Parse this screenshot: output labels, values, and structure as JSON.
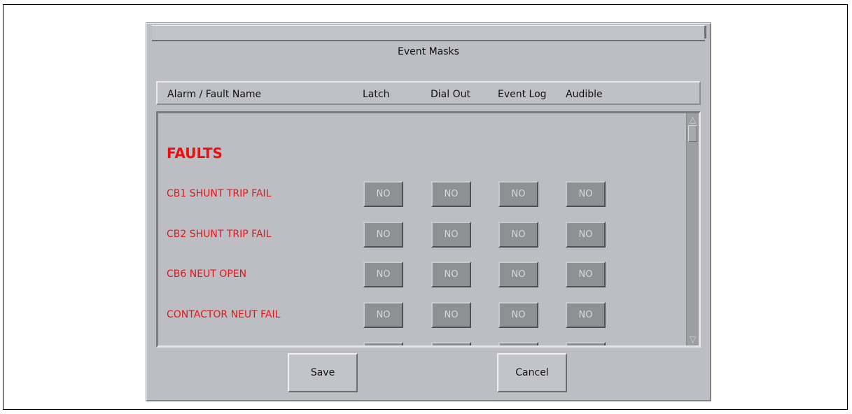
{
  "dialog": {
    "title": "Event Masks",
    "columns": {
      "name": "Alarm / Fault Name",
      "latch": "Latch",
      "dial_out": "Dial Out",
      "event_log": "Event Log",
      "audible": "Audible"
    },
    "section_heading": "FAULTS",
    "rows": [
      {
        "label": "CB1 SHUNT TRIP FAIL",
        "latch": "NO",
        "dial_out": "NO",
        "event_log": "NO",
        "audible": "NO"
      },
      {
        "label": "CB2 SHUNT TRIP FAIL",
        "latch": "NO",
        "dial_out": "NO",
        "event_log": "NO",
        "audible": "NO"
      },
      {
        "label": "CB6 NEUT OPEN",
        "latch": "NO",
        "dial_out": "NO",
        "event_log": "NO",
        "audible": "NO"
      },
      {
        "label": "CONTACTOR NEUT FAIL",
        "latch": "NO",
        "dial_out": "NO",
        "event_log": "NO",
        "audible": "NO"
      }
    ],
    "buttons": {
      "save": "Save",
      "cancel": "Cancel"
    },
    "scrollbar": {
      "up_glyph": "△",
      "down_glyph": "▽"
    }
  },
  "colors": {
    "dialog_bg": "#bdbec4",
    "fault_text": "#e0171a",
    "toggle_bg": "#8f9094"
  }
}
